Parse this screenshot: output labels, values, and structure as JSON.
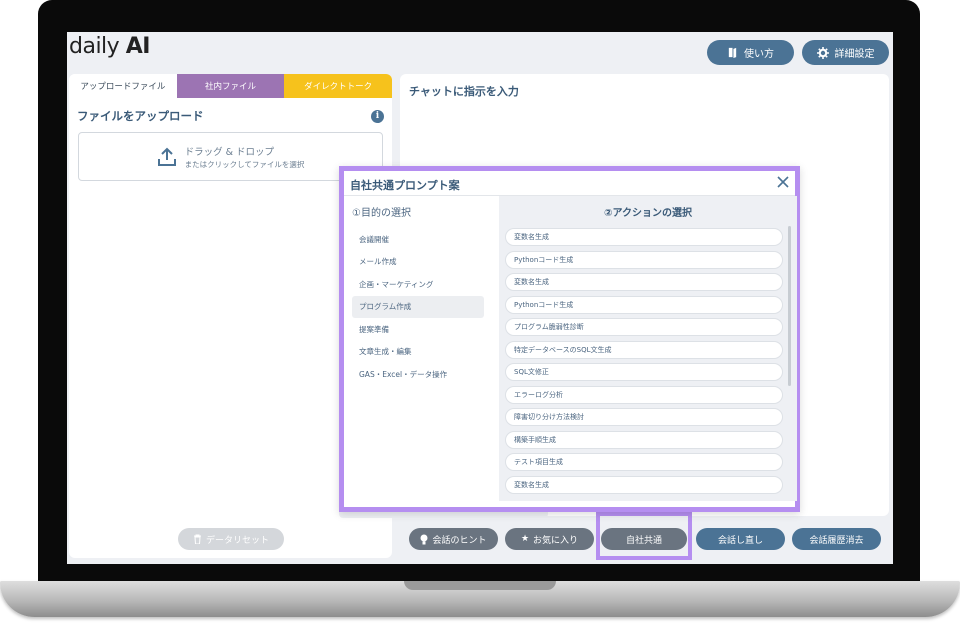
{
  "app": {
    "logo_text": "daily ",
    "logo_bold": "AI"
  },
  "header": {
    "usage_label": "使い方",
    "settings_label": "詳細設定"
  },
  "left_panel": {
    "tabs": [
      "アップロードファイル",
      "社内ファイル",
      "ダイレクトトーク"
    ],
    "upload_title": "ファイルをアップロード",
    "dropzone_main": "ドラッグ & ドロップ",
    "dropzone_sub": "またはクリックしてファイルを選択",
    "reset_label": "データリセット"
  },
  "chat": {
    "placeholder_label": "チャットに指示を入力"
  },
  "bottom_buttons": {
    "hint": "会話のヒント",
    "favorite": "お気に入り",
    "company": "自社共通",
    "retry": "会話し直し",
    "clear_history": "会話履歴消去"
  },
  "modal": {
    "title": "自社共通プロンプト案",
    "purpose_heading": "①目的の選択",
    "purposes": [
      "会議開催",
      "メール作成",
      "企画・マーケティング",
      "プログラム作成",
      "提案準備",
      "文章生成・編集",
      "GAS・Excel・データ操作"
    ],
    "active_purpose": "プログラム作成",
    "action_heading": "②アクションの選択",
    "actions": [
      "変数名生成",
      "Pythonコード生成",
      "変数名生成",
      "Pythonコード生成",
      "プログラム脆弱性診断",
      "特定データベースのSQL文生成",
      "SQL文修正",
      "エラーログ分析",
      "障害切り分け方法検討",
      "構築手順生成",
      "テスト項目生成",
      "変数名生成"
    ]
  },
  "colors": {
    "accent": "#4b7395",
    "highlight": "#b58ef0",
    "tab_internal": "#9c74b3",
    "tab_direct": "#f6c21c",
    "gray_button": "#6a7480"
  }
}
